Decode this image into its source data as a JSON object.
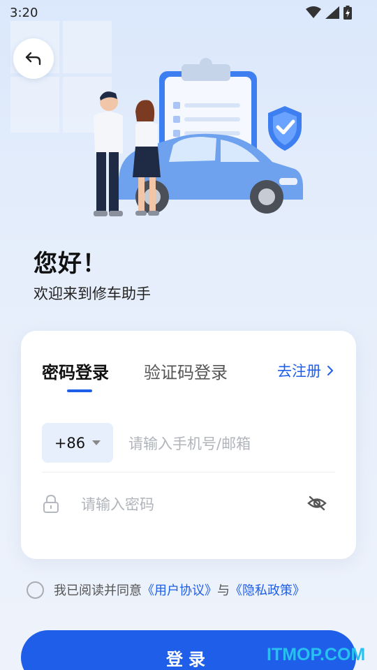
{
  "status_bar": {
    "time": "3:20",
    "icons": [
      "wifi-icon",
      "signal-icon",
      "battery-charging-icon"
    ]
  },
  "header": {
    "back_icon": "back-arrow-icon"
  },
  "hero": {
    "illustration": "people-car-checklist-shield-illustration"
  },
  "greeting": {
    "title": "您好！",
    "subtitle": "欢迎来到修车助手"
  },
  "login_card": {
    "tabs": [
      {
        "label": "密码登录",
        "active": true
      },
      {
        "label": "验证码登录",
        "active": false
      }
    ],
    "register_label": "去注册",
    "country_code": "+86",
    "phone_placeholder": "请输入手机号/邮箱",
    "password_placeholder": "请输入密码"
  },
  "agreement": {
    "prefix": "我已阅读并同意",
    "user_agreement": "《用户协议》",
    "connector": "与",
    "privacy_policy": "《隐私政策》",
    "checked": false
  },
  "login_button": {
    "label": "登录"
  },
  "watermark": {
    "text": "ITMOP.COM"
  },
  "colors": {
    "accent": "#1f5ee8",
    "background": "#e6eefb",
    "card": "#ffffff",
    "input_bg": "#e7eefc",
    "watermark": "#28c0f0"
  }
}
